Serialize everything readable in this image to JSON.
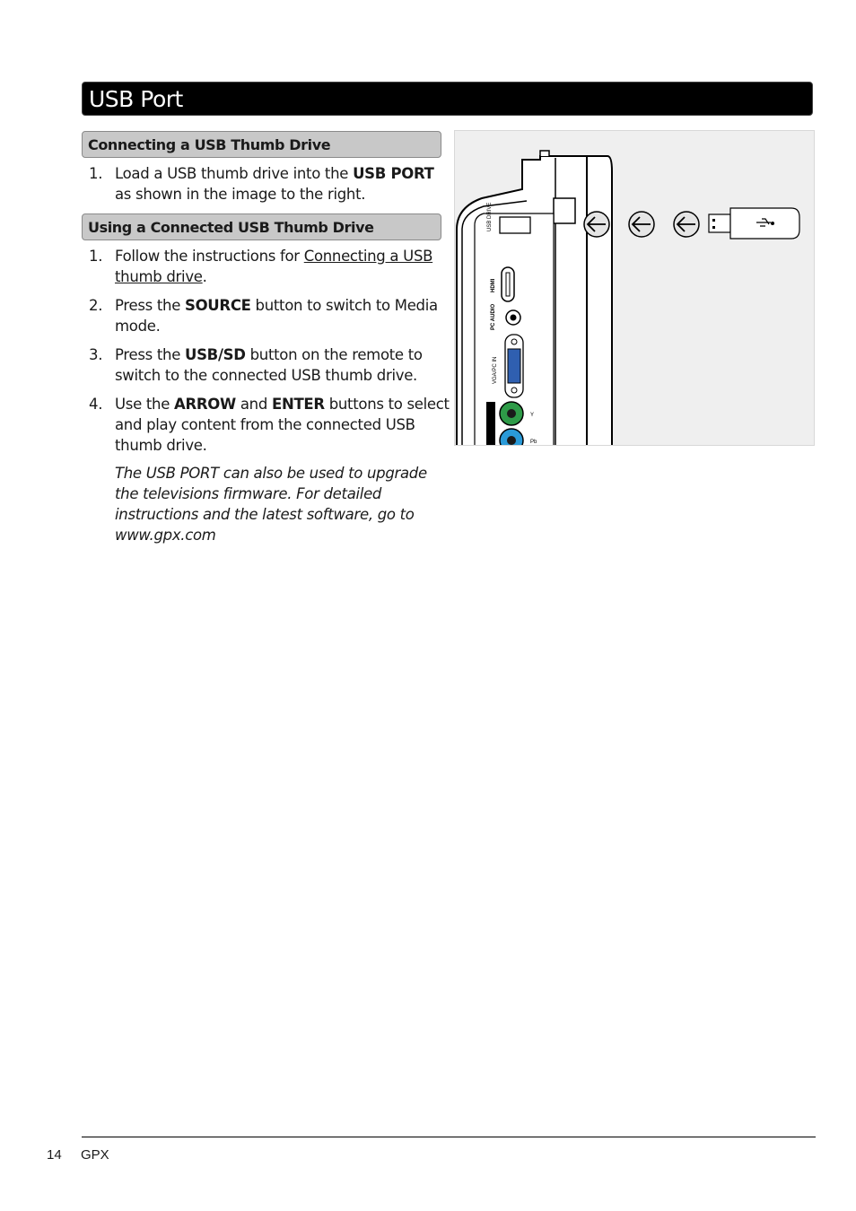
{
  "page": {
    "title": "USB Port",
    "page_number": "14",
    "footer_brand": "GPX"
  },
  "section1": {
    "heading": "Connecting a USB Thumb Drive",
    "steps": [
      {
        "num": "1.",
        "pre": "Load a USB thumb drive into the ",
        "bold": "USB PORT",
        "post": " as shown in the image to the right."
      }
    ]
  },
  "section2": {
    "heading": "Using a Connected USB Thumb Drive",
    "steps": [
      {
        "num": "1.",
        "pre": "Follow the instructions for ",
        "link": "Connecting a USB thumb drive",
        "post": "."
      },
      {
        "num": "2.",
        "pre": "Press the ",
        "bold": "SOURCE",
        "post": " button to switch to Media mode."
      },
      {
        "num": "3.",
        "pre": "Press the ",
        "bold": "USB/SD",
        "post": " button on the remote to switch to the connected USB thumb drive."
      },
      {
        "num": "4.",
        "pre": "Use the ",
        "bold": "ARROW",
        "mid": " and ",
        "bold2": "ENTER",
        "post": " buttons to select and play content from the connected USB thumb drive."
      }
    ],
    "note": "The USB PORT can also be used to upgrade the televisions firmware. For detailed instructions and the latest software, go to www.gpx.com"
  },
  "figure": {
    "port_labels": {
      "usb": "USB DRIVE",
      "hdmi": "HDMI",
      "pc_audio": "PC AUDIO",
      "vga": "VGA/PC IN",
      "y": "Y",
      "pb": "Pb"
    },
    "colors": {
      "y_jack": "#2e9b48",
      "pb_jack": "#2a9ad8",
      "vga": "#2f5fb0",
      "background": "#efefef"
    },
    "arrow_count": 3
  }
}
